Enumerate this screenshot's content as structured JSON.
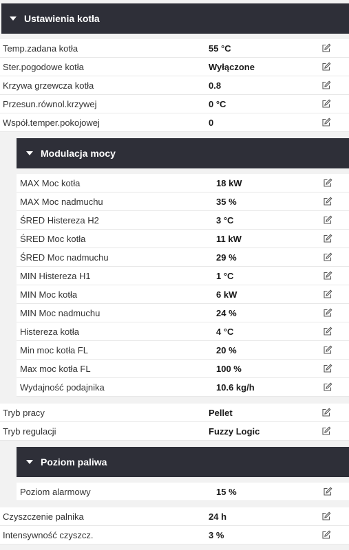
{
  "boiler_settings": {
    "title": "Ustawienia kotła",
    "rows": [
      {
        "label": "Temp.zadana kotła",
        "value": "55 °C"
      },
      {
        "label": "Ster.pogodowe kotła",
        "value": "Wyłączone"
      },
      {
        "label": "Krzywa grzewcza kotła",
        "value": "0.8"
      },
      {
        "label": "Przesun.równol.krzywej",
        "value": "0 °C"
      },
      {
        "label": "Współ.temper.pokojowej",
        "value": "0"
      }
    ]
  },
  "power_modulation": {
    "title": "Modulacja mocy",
    "rows": [
      {
        "label": "MAX Moc kotła",
        "value": "18 kW"
      },
      {
        "label": "MAX Moc nadmuchu",
        "value": "35 %"
      },
      {
        "label": "ŚRED Histereza H2",
        "value": "3 °C"
      },
      {
        "label": "ŚRED Moc kotła",
        "value": "11 kW"
      },
      {
        "label": "ŚRED Moc nadmuchu",
        "value": "29 %"
      },
      {
        "label": "MIN Histereza H1",
        "value": "1 °C"
      },
      {
        "label": "MIN Moc kotła",
        "value": "6 kW"
      },
      {
        "label": "MIN Moc nadmuchu",
        "value": "24 %"
      },
      {
        "label": "Histereza kotła",
        "value": "4 °C"
      },
      {
        "label": "Min moc kotła FL",
        "value": "20 %"
      },
      {
        "label": "Max moc kotła FL",
        "value": "100 %"
      },
      {
        "label": "Wydajność podajnika",
        "value": "10.6 kg/h"
      }
    ]
  },
  "operation": {
    "rows": [
      {
        "label": "Tryb pracy",
        "value": "Pellet"
      },
      {
        "label": "Tryb regulacji",
        "value": "Fuzzy Logic"
      }
    ]
  },
  "fuel_level": {
    "title": "Poziom paliwa",
    "rows": [
      {
        "label": "Poziom alarmowy",
        "value": "15 %"
      }
    ]
  },
  "cleaning": {
    "rows": [
      {
        "label": "Czyszczenie palnika",
        "value": "24 h"
      },
      {
        "label": "Intensywność czyszcz.",
        "value": "3 %"
      }
    ]
  },
  "icons": {
    "section_toggle": "caret-down-icon",
    "row_action": "edit-pencil-icon"
  },
  "colors": {
    "header_bg": "#2e2f38",
    "page_bg": "#f2f2f2",
    "row_bg": "#ffffff"
  }
}
